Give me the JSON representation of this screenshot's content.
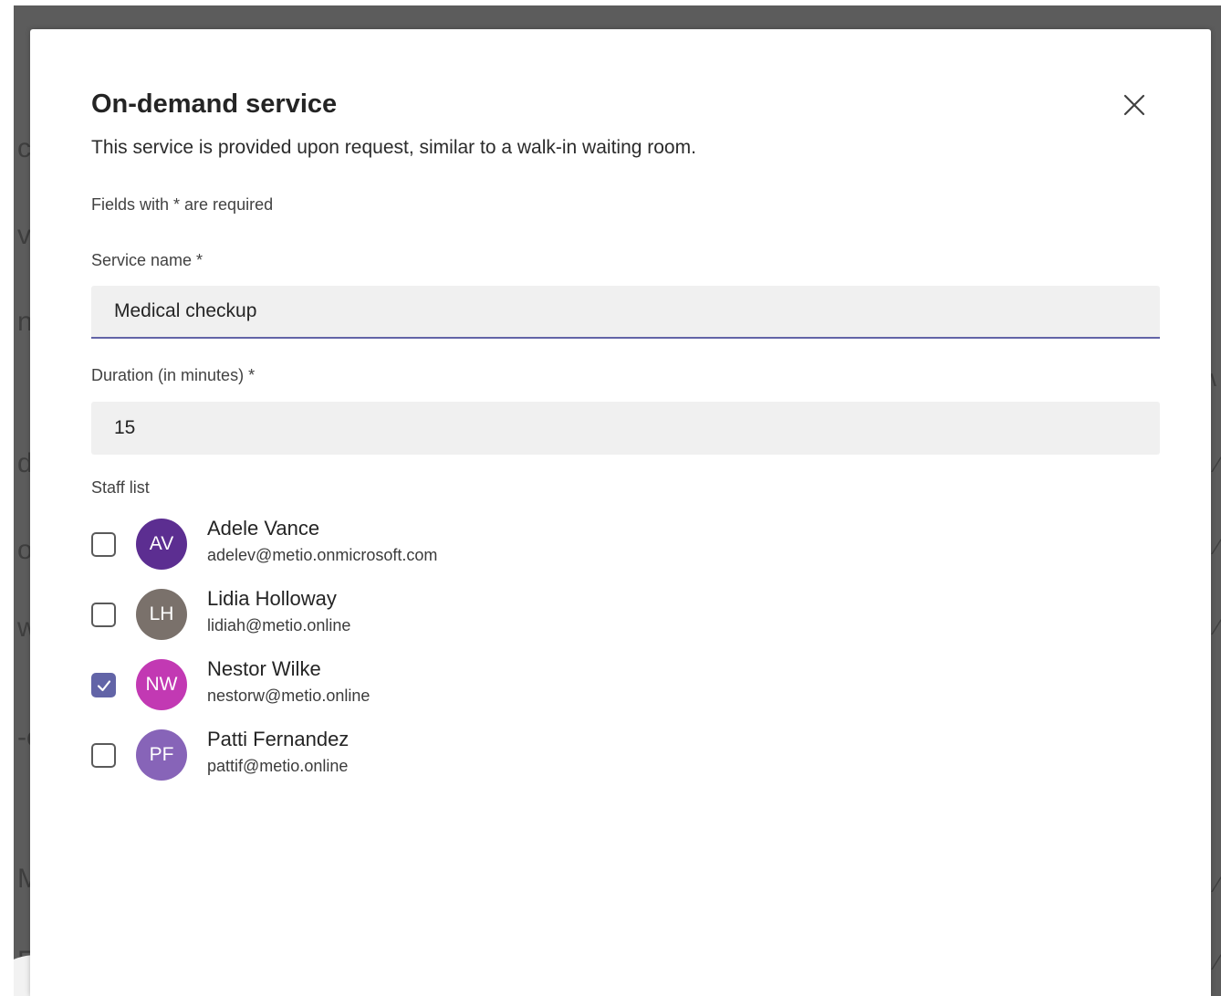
{
  "dialog": {
    "title": "On-demand service",
    "subtitle": "This service is provided upon request, similar to a walk-in waiting room.",
    "required_note": "Fields with * are required",
    "close_icon": "close-icon"
  },
  "form": {
    "service_name": {
      "label": "Service name *",
      "value": "Medical checkup"
    },
    "duration": {
      "label": "Duration (in minutes) *",
      "value": "15"
    },
    "staff_label": "Staff list"
  },
  "staff": [
    {
      "initials": "AV",
      "name": "Adele Vance",
      "email": "adelev@metio.onmicrosoft.com",
      "checked": false,
      "color": "#5c2e91"
    },
    {
      "initials": "LH",
      "name": "Lidia Holloway",
      "email": "lidiah@metio.online",
      "checked": false,
      "color": "#7a716b"
    },
    {
      "initials": "NW",
      "name": "Nestor Wilke",
      "email": "nestorw@metio.online",
      "checked": true,
      "color": "#c239b3"
    },
    {
      "initials": "PF",
      "name": "Patti Fernandez",
      "email": "pattif@metio.online",
      "checked": false,
      "color": "#8764b8"
    }
  ],
  "colors": {
    "accent": "#6264a7",
    "backdrop": "#5c5c5c",
    "field_bg": "#f0f0f0"
  }
}
